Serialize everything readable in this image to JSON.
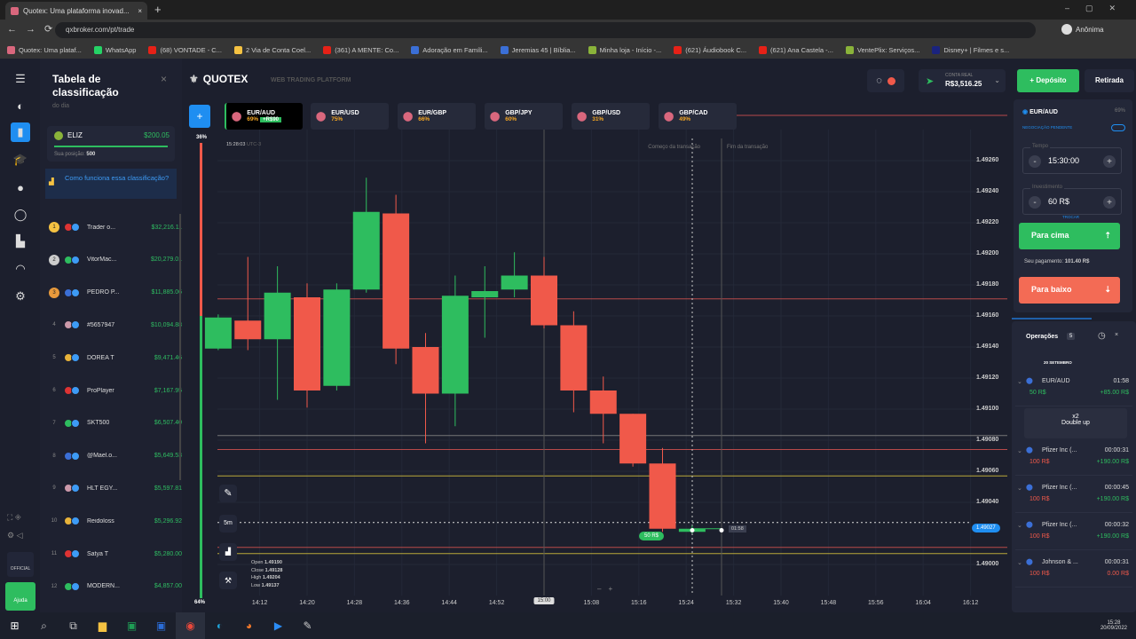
{
  "browser": {
    "tab_title": "Quotex: Uma plataforma inovad...",
    "url": "qxbroker.com/pt/trade",
    "profile": "Anônima",
    "bookmarks": [
      "Quotex: Uma plataf...",
      "WhatsApp",
      "(68) VONTADE - C...",
      "2 Via de Conta Coel...",
      "(361) A MENTE: Co...",
      "Adoração em Famíli...",
      "Jeremias 45 | Bíblia...",
      "Minha loja - Início -...",
      "(621) Áudiobook C...",
      "(621) Ana Castela -...",
      "VentePlix: Serviços...",
      "Disney+ | Filmes e s..."
    ]
  },
  "leaderboard": {
    "title": "Tabela de classificação",
    "subtitle": "do dia",
    "user": {
      "name": "ELIZ",
      "amount": "$200.05",
      "position_label": "Sua posição:",
      "position": "500"
    },
    "help": "Como funciona essa classificação?",
    "rows": [
      {
        "rank": "1",
        "name": "Trader o...",
        "amount": "$32,216.11"
      },
      {
        "rank": "2",
        "name": "VitorMac...",
        "amount": "$20,279.01"
      },
      {
        "rank": "3",
        "name": "PEDRO P...",
        "amount": "$11,885.06"
      },
      {
        "rank": "4",
        "name": "#5657947",
        "amount": "$10,094.88"
      },
      {
        "rank": "5",
        "name": "DÓREA T",
        "amount": "$9,471.46"
      },
      {
        "rank": "6",
        "name": "ProPlayer",
        "amount": "$7,167.95"
      },
      {
        "rank": "7",
        "name": "SKT500",
        "amount": "$6,507.40"
      },
      {
        "rank": "8",
        "name": "@Mael.o...",
        "amount": "$5,649.53"
      },
      {
        "rank": "9",
        "name": "HLT EGY...",
        "amount": "$5,597.81"
      },
      {
        "rank": "10",
        "name": "Reidoloss",
        "amount": "$5,296.92"
      },
      {
        "rank": "11",
        "name": "Satya T",
        "amount": "$5,280.00"
      },
      {
        "rank": "12",
        "name": "MODERN...",
        "amount": "$4,857.00"
      }
    ],
    "help_button": "Ajuda",
    "official": "OFFICIAL"
  },
  "header": {
    "brand": "QUOTEX",
    "tagline": "WEB TRADING PLATFORM",
    "account_label": "CONTA REAL",
    "balance": "R$3,516.25",
    "deposit": "Depósito",
    "withdraw": "Retirada"
  },
  "assets": [
    {
      "name": "EUR/AUD",
      "pct": "69%",
      "badge": "+R$90"
    },
    {
      "name": "EUR/USD",
      "pct": "75%"
    },
    {
      "name": "EUR/GBP",
      "pct": "66%"
    },
    {
      "name": "GBP/JPY",
      "pct": "60%"
    },
    {
      "name": "GBP/USD",
      "pct": "31%"
    },
    {
      "name": "GBP/CAD",
      "pct": "49%"
    }
  ],
  "chart_info": {
    "time": "15:28:03",
    "tz": "UTC-3",
    "sentiment_top": "36%",
    "sentiment_bottom": "64%",
    "start_label": "Começo da transação",
    "end_label": "Fim da transação",
    "current_price": "1.49027",
    "trade_marker": "50 R$",
    "timer": "01:58",
    "timeframe": "5m",
    "crosshair_time": "15:00",
    "ohlc": {
      "open_label": "Open",
      "open": "1.49190",
      "close_label": "Close",
      "close": "1.49128",
      "high_label": "High",
      "high": "1.49204",
      "low_label": "Low",
      "low": "1.49137"
    }
  },
  "chart_data": {
    "type": "candlestick",
    "ylim": [
      1.48985,
      1.49275
    ],
    "yticks": [
      "1.49260",
      "1.49240",
      "1.49220",
      "1.49200",
      "1.49180",
      "1.49160",
      "1.49140",
      "1.49120",
      "1.49100",
      "1.49080",
      "1.49060",
      "1.49040",
      "1.49000"
    ],
    "xticks": [
      "14:12",
      "14:20",
      "14:28",
      "14:36",
      "14:44",
      "14:52",
      "15:08",
      "15:16",
      "15:24",
      "15:32",
      "15:40",
      "15:48",
      "15:56",
      "16:04",
      "16:12"
    ],
    "candles": [
      {
        "t": "14:05",
        "o": 1.49139,
        "h": 1.49161,
        "l": 1.49138,
        "c": 1.49159
      },
      {
        "t": "14:10",
        "o": 1.49157,
        "h": 1.49198,
        "l": 1.49138,
        "c": 1.49145
      },
      {
        "t": "14:15",
        "o": 1.49145,
        "h": 1.49192,
        "l": 1.49106,
        "c": 1.49175
      },
      {
        "t": "14:20",
        "o": 1.49172,
        "h": 1.49181,
        "l": 1.49101,
        "c": 1.49112
      },
      {
        "t": "14:25",
        "o": 1.49115,
        "h": 1.49181,
        "l": 1.49112,
        "c": 1.49177
      },
      {
        "t": "14:30",
        "o": 1.49177,
        "h": 1.49249,
        "l": 1.49175,
        "c": 1.49227
      },
      {
        "t": "14:35",
        "o": 1.49226,
        "h": 1.49238,
        "l": 1.49129,
        "c": 1.49139
      },
      {
        "t": "14:40",
        "o": 1.4914,
        "h": 1.49149,
        "l": 1.49078,
        "c": 1.4911
      },
      {
        "t": "14:45",
        "o": 1.4911,
        "h": 1.49186,
        "l": 1.49089,
        "c": 1.49173
      },
      {
        "t": "14:50",
        "o": 1.49172,
        "h": 1.49192,
        "l": 1.49146,
        "c": 1.49176
      },
      {
        "t": "14:55",
        "o": 1.49177,
        "h": 1.49201,
        "l": 1.49172,
        "c": 1.49186
      },
      {
        "t": "15:00",
        "o": 1.49186,
        "h": 1.49198,
        "l": 1.49152,
        "c": 1.49154
      },
      {
        "t": "15:05",
        "o": 1.49154,
        "h": 1.49163,
        "l": 1.49098,
        "c": 1.49112
      },
      {
        "t": "15:10",
        "o": 1.49112,
        "h": 1.49121,
        "l": 1.49078,
        "c": 1.49097
      },
      {
        "t": "15:15",
        "o": 1.49097,
        "h": 1.49097,
        "l": 1.49063,
        "c": 1.49065
      },
      {
        "t": "15:20",
        "o": 1.49065,
        "h": 1.49075,
        "l": 1.49021,
        "c": 1.49023
      },
      {
        "t": "15:25",
        "o": 1.49021,
        "h": 1.49025,
        "l": 1.4902,
        "c": 1.49023
      }
    ],
    "levels": [
      {
        "price": 1.49171,
        "color": "#b84a4a"
      },
      {
        "price": 1.49083,
        "color": "#777777"
      },
      {
        "price": 1.49074,
        "color": "#b84a4a"
      },
      {
        "price": 1.49057,
        "color": "#b9a93a"
      },
      {
        "price": 1.49011,
        "color": "#b84a4a"
      },
      {
        "price": 1.49007,
        "color": "#b9a93a"
      }
    ]
  },
  "trade_panel": {
    "asset": "EUR/AUD",
    "pct": "69%",
    "pending": "NEGOCIAÇÃO PENDENTE",
    "time_label": "Tempo",
    "time": "15:30:00",
    "invest_label": "Investimento",
    "invest": "60 R$",
    "switch": "TROCAR",
    "up": "Para cima",
    "payout_label": "Seu pagamento:",
    "payout": "101.40 R$",
    "down": "Para baixo"
  },
  "operations": {
    "title": "Operações",
    "count": "5",
    "date": "20 SETEMBRO",
    "double_x": "x2",
    "double_label": "Double up",
    "items": [
      {
        "name": "EUR/AUD",
        "time": "01:58",
        "amount": "50 R$",
        "result": "+85.00 R$",
        "up": true
      },
      {
        "name": "Pfizer Inc (...",
        "time": "00:00:31",
        "amount": "100 R$",
        "result": "+190.00 R$",
        "up": false
      },
      {
        "name": "Pfizer Inc (...",
        "time": "00:00:45",
        "amount": "100 R$",
        "result": "+190.00 R$",
        "up": false
      },
      {
        "name": "Pfizer Inc (...",
        "time": "00:00:32",
        "amount": "100 R$",
        "result": "+190.00 R$",
        "up": false
      },
      {
        "name": "Johnson & ...",
        "time": "00:00:31",
        "amount": "100 R$",
        "result": "0.00 R$",
        "up": false
      }
    ]
  },
  "taskbar": {
    "time": "15:28",
    "date": "20/09/2022"
  },
  "colors": {
    "green": "#2ebd5f",
    "red": "#f0594a",
    "blue": "#1f8ef1",
    "bg": "#1c1f2d"
  }
}
